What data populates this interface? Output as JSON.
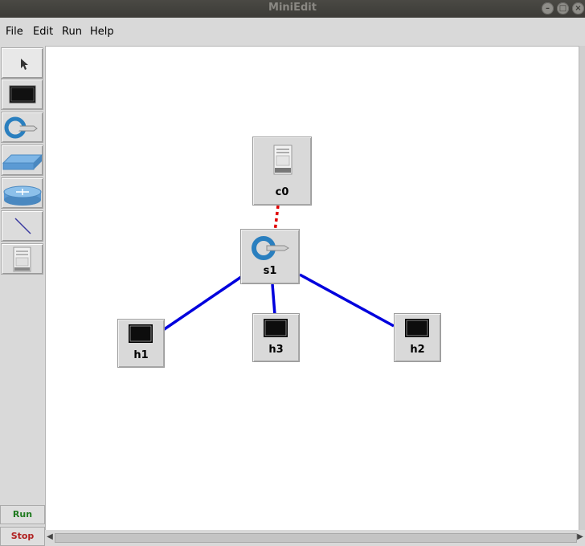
{
  "window": {
    "title": "MiniEdit"
  },
  "menu": [
    "File",
    "Edit",
    "Run",
    "Help"
  ],
  "toolbar": {
    "tools": [
      "select",
      "host",
      "switch",
      "legacy-switch",
      "legacy-router",
      "link",
      "controller"
    ],
    "run_label": "Run",
    "stop_label": "Stop"
  },
  "nodes": {
    "c0": {
      "label": "c0",
      "type": "controller"
    },
    "s1": {
      "label": "s1",
      "type": "switch"
    },
    "h1": {
      "label": "h1",
      "type": "host"
    },
    "h2": {
      "label": "h2",
      "type": "host"
    },
    "h3": {
      "label": "h3",
      "type": "host"
    }
  },
  "links": [
    {
      "from": "c0",
      "to": "s1",
      "kind": "control",
      "color": "#e00000"
    },
    {
      "from": "s1",
      "to": "h1",
      "kind": "data",
      "color": "#0000dd"
    },
    {
      "from": "s1",
      "to": "h3",
      "kind": "data",
      "color": "#0000dd"
    },
    {
      "from": "s1",
      "to": "h2",
      "kind": "data",
      "color": "#0000dd"
    }
  ],
  "colors": {
    "run": "#1f7a1f",
    "stop": "#b02020",
    "link": "#0000dd",
    "control_link": "#e00000"
  }
}
